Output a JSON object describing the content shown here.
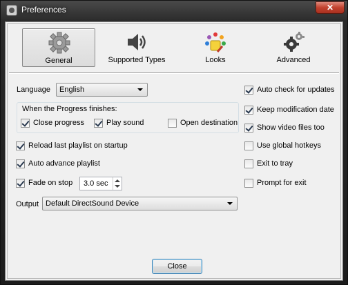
{
  "window": {
    "title": "Preferences",
    "close_glyph": "✕"
  },
  "toolbar": {
    "items": [
      {
        "label": "General",
        "icon": "gear-icon",
        "active": true
      },
      {
        "label": "Supported Types",
        "icon": "speaker-icon"
      },
      {
        "label": "Looks",
        "icon": "palette-icon"
      },
      {
        "label": "Advanced",
        "icon": "gears-icon"
      }
    ]
  },
  "general": {
    "language_label": "Language",
    "language_value": "English",
    "progress_group_title": "When the Progress finishes:",
    "progress_options": [
      {
        "label": "Close progress",
        "checked": true
      },
      {
        "label": "Play sound",
        "checked": true
      },
      {
        "label": "Open destination",
        "checked": false
      }
    ],
    "left_options": [
      {
        "label": "Reload last playlist on startup",
        "checked": true
      },
      {
        "label": "Auto advance playlist",
        "checked": true
      },
      {
        "label": "Fade on stop",
        "checked": true
      }
    ],
    "fade_value": "3.0 sec",
    "right_options": [
      {
        "label": "Auto check for updates",
        "checked": true
      },
      {
        "label": "Keep modification date",
        "checked": true
      },
      {
        "label": "Show video files too",
        "checked": true
      },
      {
        "label": "Use global hotkeys",
        "checked": false
      },
      {
        "label": "Exit to tray",
        "checked": false
      },
      {
        "label": "Prompt for exit",
        "checked": false
      }
    ],
    "output_label": "Output",
    "output_value": "Default DirectSound Device"
  },
  "footer": {
    "close_label": "Close"
  }
}
